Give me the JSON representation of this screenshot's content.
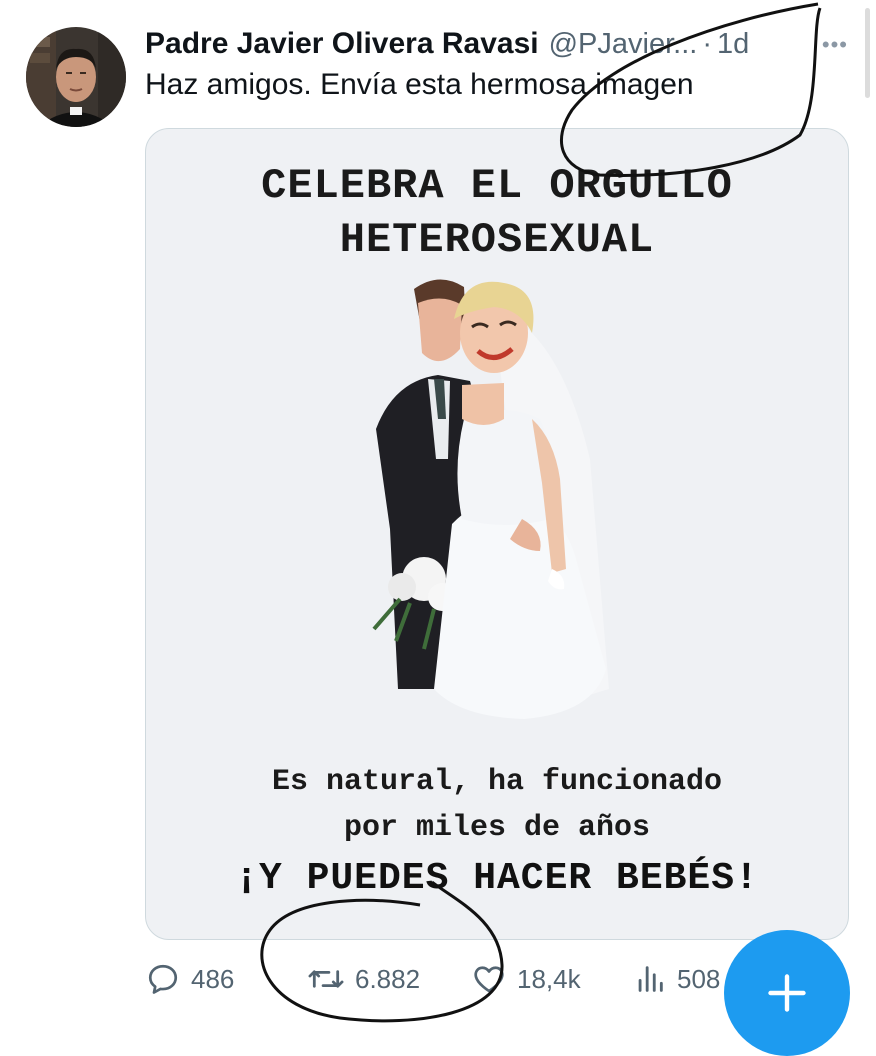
{
  "tweet": {
    "author_name": "Padre Javier Olivera Ravasi",
    "author_handle": "@PJavier...",
    "separator": "·",
    "timestamp": "1d",
    "text": "Haz amigos. Envía esta hermosa imagen"
  },
  "media": {
    "title_line1": "CELEBRA EL ORGULLO",
    "title_line2": "HETEROSEXUAL",
    "caption_line1": "Es natural, ha funcionado",
    "caption_line2": "por miles de años",
    "cta": "¡Y PUEDES HACER BEBÉS!"
  },
  "actions": {
    "replies": "486",
    "reposts": "6.882",
    "likes": "18,4k",
    "views": "508"
  },
  "icons": {
    "reply": "reply-icon",
    "repost": "repost-icon",
    "like": "heart-icon",
    "views": "views-icon",
    "more": "more-icon",
    "compose": "plus-icon"
  },
  "colors": {
    "accent": "#1d9bf0",
    "secondary_text": "#536471",
    "primary_text": "#0f1419"
  }
}
